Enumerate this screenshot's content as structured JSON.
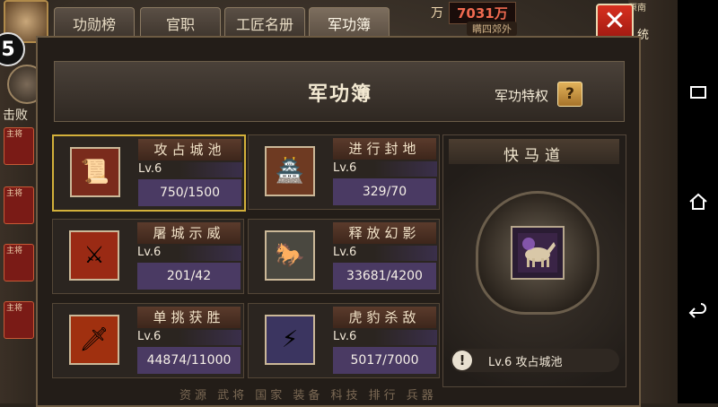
{
  "top": {
    "money_unit": "万",
    "money_value": "7031万",
    "place_label": "原南",
    "quit_label": "统",
    "chip_text": "瞒四郊外"
  },
  "tabs": [
    {
      "label": "功勋榜",
      "active": false
    },
    {
      "label": "官职",
      "active": false
    },
    {
      "label": "工匠名册",
      "active": false
    },
    {
      "label": "军功簿",
      "active": true
    }
  ],
  "left": {
    "level_badge": "5",
    "defeat_label": "击败",
    "strip_text": "主将"
  },
  "panel": {
    "title": "军功簿",
    "privilege_label": "军功特权",
    "help_icon": "?"
  },
  "cards": [
    {
      "name": "攻占城池",
      "level": "Lv.6",
      "value": "750/1500",
      "icon": "scroll-icon",
      "selected": true
    },
    {
      "name": "进行封地",
      "level": "Lv.6",
      "value": "329/70",
      "icon": "treasure-icon",
      "selected": false
    },
    {
      "name": "屠城示威",
      "level": "Lv.6",
      "value": "201/42",
      "icon": "warrior-icon",
      "selected": false
    },
    {
      "name": "释放幻影",
      "level": "Lv.6",
      "value": "33681/4200",
      "icon": "phantom-icon",
      "selected": false
    },
    {
      "name": "单挑获胜",
      "level": "Lv.6",
      "value": "44874/11000",
      "icon": "duel-icon",
      "selected": false
    },
    {
      "name": "虎豹杀敌",
      "level": "Lv.6",
      "value": "5017/7000",
      "icon": "slash-icon",
      "selected": false
    }
  ],
  "road": {
    "title": "快马道",
    "footer_text": "Lv.6 攻占城池",
    "icon": "horse-icon"
  },
  "bottom_text": "资源 武将 国家 装备 科技 排行 兵器"
}
